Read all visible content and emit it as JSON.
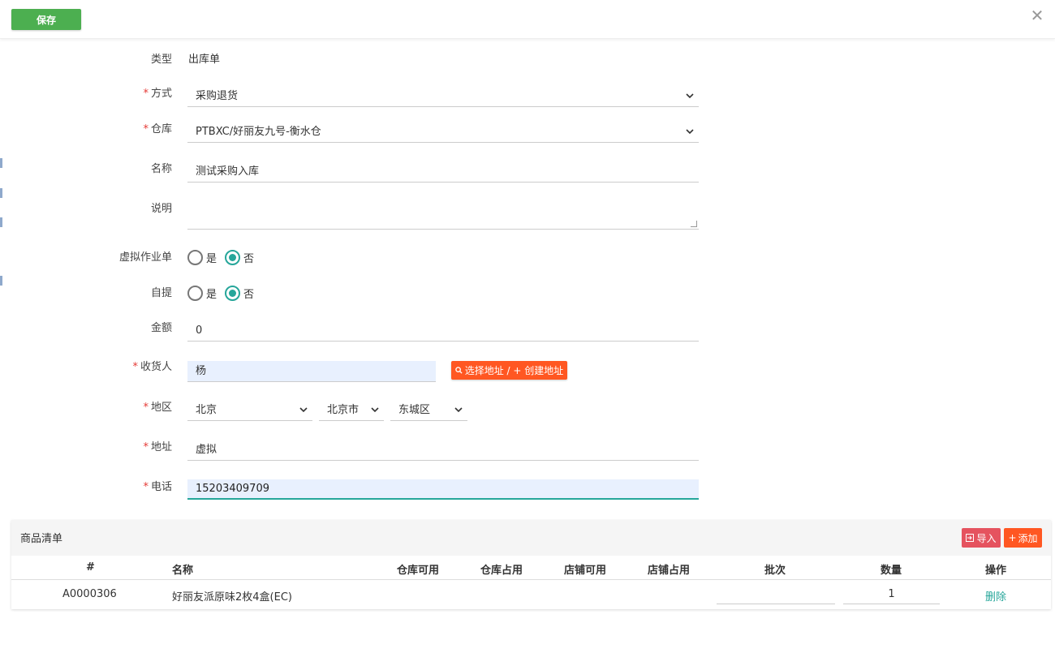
{
  "toolbar": {
    "save_label": "保存",
    "close_glyph": "✕"
  },
  "form": {
    "type": {
      "label": "类型",
      "value": "出库单"
    },
    "method": {
      "label": "方式",
      "value": "采购退货"
    },
    "warehouse": {
      "label": "仓库",
      "value": "PTBXC/好丽友九号-衡水仓"
    },
    "name": {
      "label": "名称",
      "value": "测试采购入库"
    },
    "description": {
      "label": "说明",
      "value": ""
    },
    "virtual_order": {
      "label": "虚拟作业单",
      "yes": "是",
      "no": "否",
      "selected": "否"
    },
    "self_pickup": {
      "label": "自提",
      "yes": "是",
      "no": "否",
      "selected": "否"
    },
    "amount": {
      "label": "金额",
      "value": "0"
    },
    "consignee": {
      "label": "收货人",
      "value": "杨",
      "address_button": "选择地址 / + 创建地址"
    },
    "region": {
      "label": "地区",
      "province": "北京",
      "city": "北京市",
      "district": "东城区"
    },
    "address": {
      "label": "地址",
      "value": "虚拟"
    },
    "phone": {
      "label": "电话",
      "value": "15203409709"
    }
  },
  "goods": {
    "title": "商品清单",
    "import_label": "导入",
    "add_label": "添加",
    "columns": [
      "#",
      "名称",
      "仓库可用",
      "仓库占用",
      "店铺可用",
      "店铺占用",
      "批次",
      "数量",
      "操作"
    ],
    "rows": [
      {
        "code": "A0000306",
        "name": "好丽友派原味2枚4盒(EC)",
        "batch": "",
        "quantity": "1",
        "action": "删除"
      }
    ]
  },
  "colors": {
    "primary_green": "#4caf50",
    "accent_orange": "#ff5722",
    "teal": "#26a69a",
    "danger_red": "#e5535f"
  }
}
